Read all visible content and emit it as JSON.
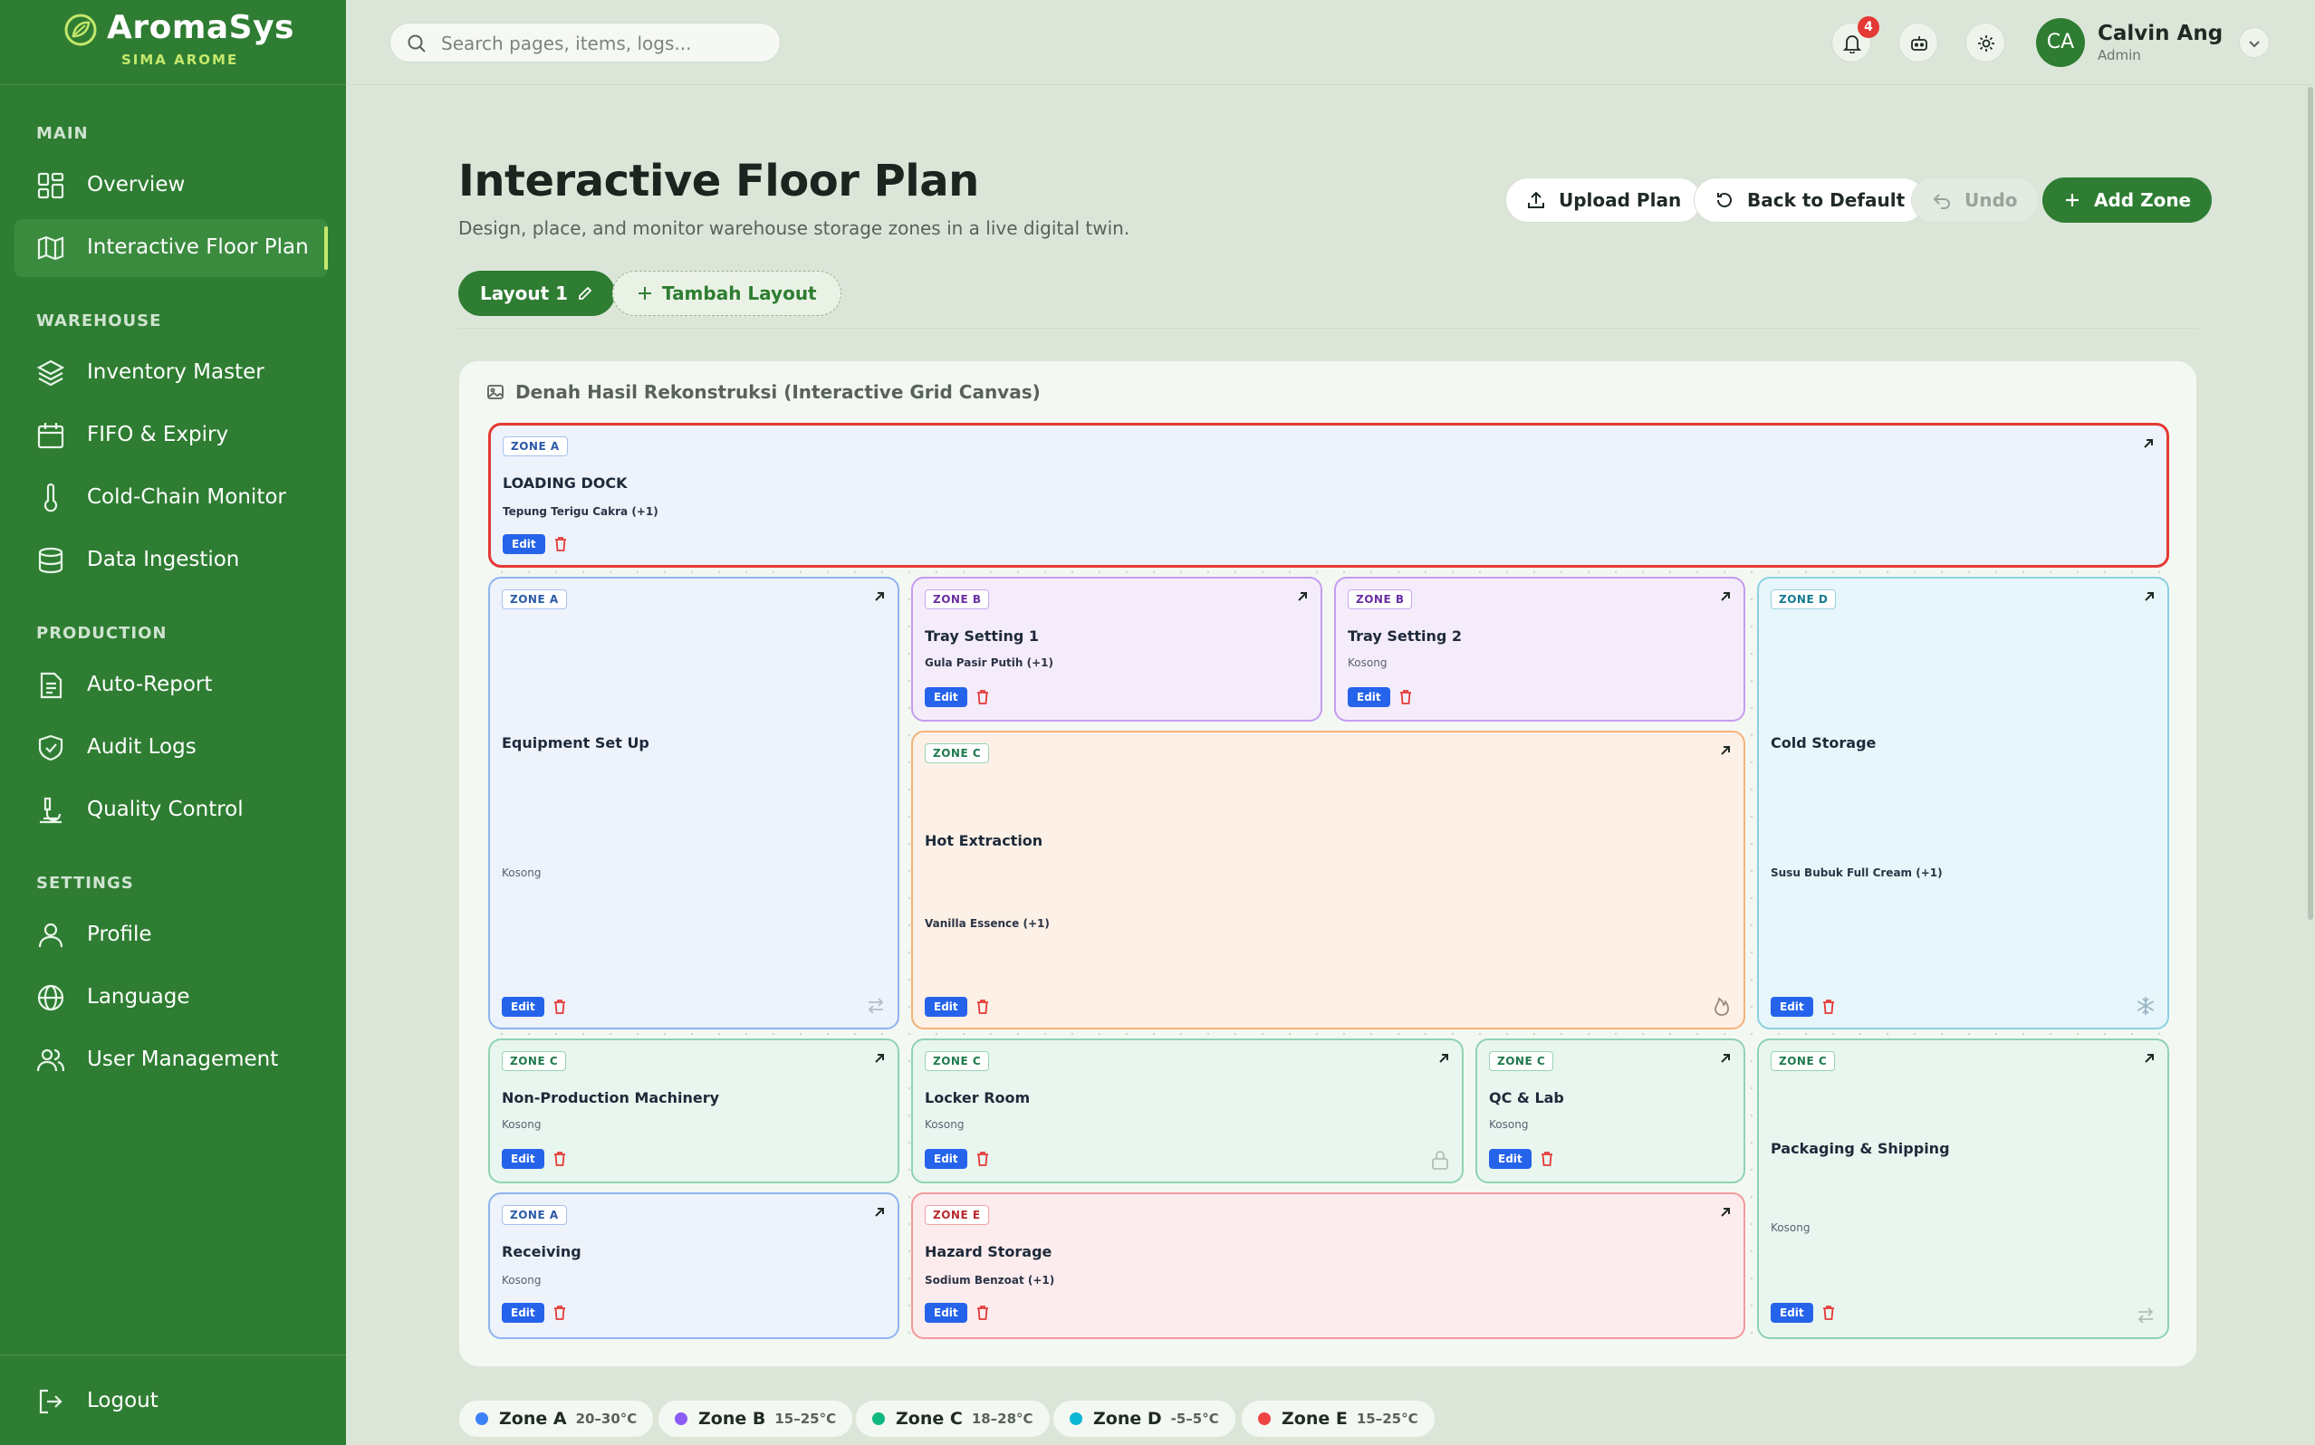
{
  "brand": {
    "name": "AromaSys",
    "subtitle": "SIMA AROME"
  },
  "sidebar": {
    "sections": [
      {
        "label": "MAIN",
        "items": [
          {
            "label": "Overview",
            "icon": "grid-icon"
          },
          {
            "label": "Interactive Floor Plan",
            "icon": "map-icon",
            "active": true
          }
        ]
      },
      {
        "label": "WAREHOUSE",
        "items": [
          {
            "label": "Inventory Master",
            "icon": "layers-icon"
          },
          {
            "label": "FIFO & Expiry",
            "icon": "calendar-icon"
          },
          {
            "label": "Cold-Chain Monitor",
            "icon": "thermometer-icon"
          },
          {
            "label": "Data Ingestion",
            "icon": "database-icon"
          }
        ]
      },
      {
        "label": "PRODUCTION",
        "items": [
          {
            "label": "Auto-Report",
            "icon": "report-icon"
          },
          {
            "label": "Audit Logs",
            "icon": "shield-check-icon"
          },
          {
            "label": "Quality Control",
            "icon": "microscope-icon"
          }
        ]
      },
      {
        "label": "SETTINGS",
        "items": [
          {
            "label": "Profile",
            "icon": "user-icon"
          },
          {
            "label": "Language",
            "icon": "globe-icon"
          },
          {
            "label": "User Management",
            "icon": "users-icon"
          }
        ]
      }
    ],
    "logout": "Logout"
  },
  "topbar": {
    "search_placeholder": "Search pages, items, logs...",
    "notification_count": "4",
    "user": {
      "initials": "CA",
      "name": "Calvin Ang",
      "role": "Admin"
    }
  },
  "header": {
    "title": "Interactive Floor Plan",
    "subtitle": "Design, place, and monitor warehouse storage zones in a live digital twin.",
    "buttons": {
      "upload": "Upload Plan",
      "reset": "Back to Default",
      "undo": "Undo",
      "add": "Add Zone"
    }
  },
  "layouts": {
    "current": "Layout 1",
    "add": "Tambah Layout"
  },
  "canvas": {
    "title": "Denah Hasil Rekonstruksi (Interactive Grid Canvas)",
    "edit_label": "Edit",
    "zones": [
      {
        "zone": "ZONE A",
        "name": "LOADING DOCK",
        "content": "Tepung Terigu Cakra (+1)"
      },
      {
        "zone": "ZONE A",
        "name": "Equipment Set Up",
        "content": "Kosong"
      },
      {
        "zone": "ZONE B",
        "name": "Tray Setting 1",
        "content": "Gula Pasir Putih (+1)"
      },
      {
        "zone": "ZONE B",
        "name": "Tray Setting 2",
        "content": "Kosong"
      },
      {
        "zone": "ZONE D",
        "name": "Cold Storage",
        "content": "Susu Bubuk Full Cream (+1)"
      },
      {
        "zone": "ZONE C",
        "name": "Hot Extraction",
        "content": "Vanilla Essence (+1)"
      },
      {
        "zone": "ZONE C",
        "name": "Non-Production Machinery",
        "content": "Kosong"
      },
      {
        "zone": "ZONE C",
        "name": "Locker Room",
        "content": "Kosong"
      },
      {
        "zone": "ZONE C",
        "name": "QC & Lab",
        "content": "Kosong"
      },
      {
        "zone": "ZONE C",
        "name": "Packaging & Shipping",
        "content": "Kosong"
      },
      {
        "zone": "ZONE A",
        "name": "Receiving",
        "content": "Kosong"
      },
      {
        "zone": "ZONE E",
        "name": "Hazard Storage",
        "content": "Sodium Benzoat (+1)"
      }
    ]
  },
  "legend": [
    {
      "name": "Zone A",
      "range": "20–30°C",
      "color": "#3b82f6"
    },
    {
      "name": "Zone B",
      "range": "15–25°C",
      "color": "#8b5cf6"
    },
    {
      "name": "Zone C",
      "range": "18–28°C",
      "color": "#10b981"
    },
    {
      "name": "Zone D",
      "range": "-5–5°C",
      "color": "#06b6d4"
    },
    {
      "name": "Zone E",
      "range": "15–25°C",
      "color": "#ef4444"
    }
  ],
  "colors": {
    "sidebar": "#2e7d32",
    "accent": "#c5e86c",
    "primary": "#2e7d32",
    "edit": "#2563eb",
    "selected": "#e53935"
  }
}
